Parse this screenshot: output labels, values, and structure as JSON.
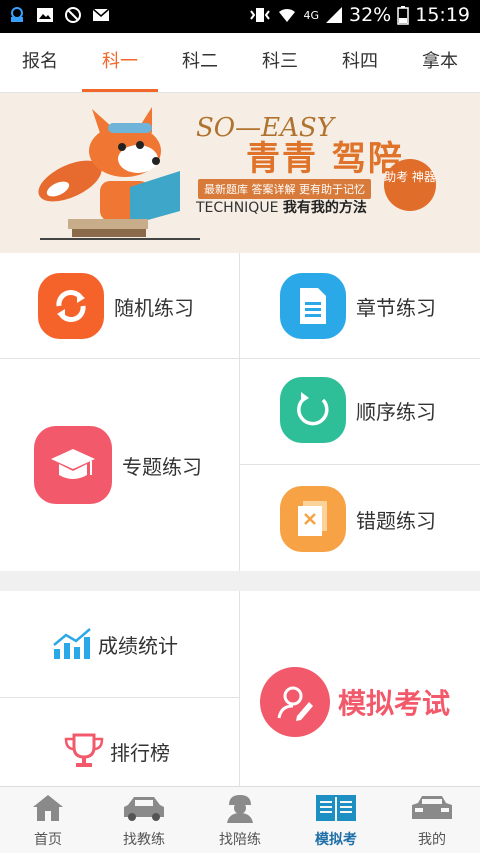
{
  "status_bar": {
    "battery": "32%",
    "time": "15:19",
    "network": "4G"
  },
  "tabs": [
    {
      "label": "报名"
    },
    {
      "label": "科一",
      "active": true
    },
    {
      "label": "科二"
    },
    {
      "label": "科三"
    },
    {
      "label": "科四"
    },
    {
      "label": "拿本"
    }
  ],
  "banner": {
    "brand": "SO—EASY",
    "headline": "青青 驾陪",
    "tagline": "最新题库  答案详解  更有助于记忆",
    "method_en": "TECHNIQUE",
    "method_cn": "我有我的方法",
    "badge": "助考 神器"
  },
  "practice": {
    "random": {
      "label": "随机练习",
      "color": "#f5632b",
      "icon": "refresh-icon"
    },
    "chapter": {
      "label": "章节练习",
      "color": "#2aa8e8",
      "icon": "document-icon"
    },
    "sequential": {
      "label": "顺序练习",
      "color": "#2fbf98",
      "icon": "circular-arrow-icon"
    },
    "topic": {
      "label": "专题练习",
      "color": "#f2596a",
      "icon": "graduation-cap-icon"
    },
    "mistakes": {
      "label": "错题练习",
      "color": "#f7a345",
      "icon": "wrong-doc-icon"
    }
  },
  "extras": {
    "stats": {
      "label": "成绩统计",
      "icon": "bar-chart-icon"
    },
    "ranking": {
      "label": "排行榜",
      "icon": "trophy-icon"
    },
    "mock_exam": {
      "label": "模拟考试",
      "color": "#f2596a",
      "icon": "pencil-user-icon"
    }
  },
  "bottom_nav": [
    {
      "label": "首页",
      "icon": "home-icon"
    },
    {
      "label": "找教练",
      "icon": "car-icon"
    },
    {
      "label": "找陪练",
      "icon": "driver-icon"
    },
    {
      "label": "模拟考",
      "icon": "book-icon",
      "active": true
    },
    {
      "label": "我的",
      "icon": "car-front-icon"
    }
  ]
}
